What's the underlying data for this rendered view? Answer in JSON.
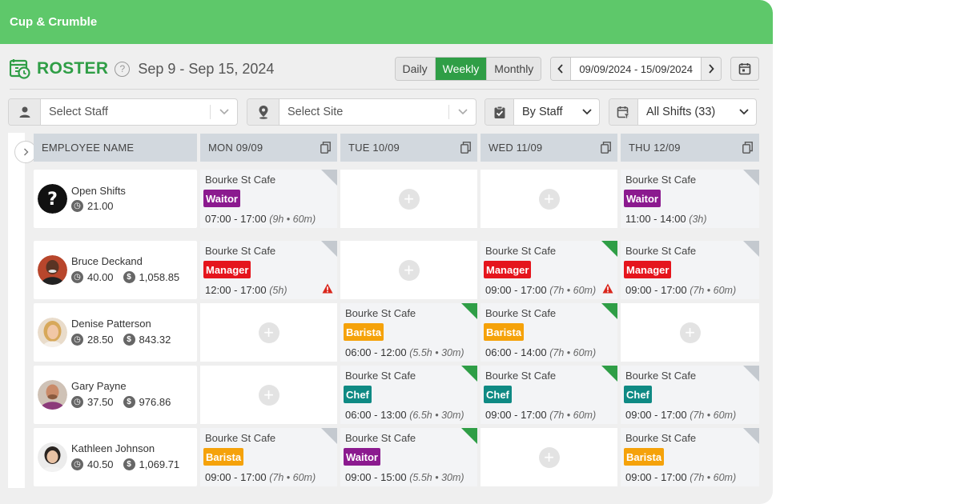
{
  "brand": "Cup & Crumble",
  "header": {
    "title": "ROSTER",
    "help": "?",
    "date_range": "Sep 9 - Sep 15, 2024",
    "views": [
      "Daily",
      "Weekly",
      "Monthly"
    ],
    "active_view": "Weekly",
    "date_field": "09/09/2024 - 15/09/2024"
  },
  "filters": {
    "staff_placeholder": "Select Staff",
    "site_placeholder": "Select Site",
    "group_by": "By Staff",
    "shifts": "All Shifts (33)"
  },
  "columns": [
    "EMPLOYEE NAME",
    "MON 09/09",
    "TUE 10/09",
    "WED 11/09",
    "THU 12/09"
  ],
  "role_colors": {
    "Waitor": "#8b1a8f",
    "Manager": "#e5151d",
    "Barista": "#f5a20a",
    "Chef": "#0f8a84"
  },
  "employees": [
    {
      "name": "Open Shifts",
      "hours": "21.00",
      "pay": "",
      "avatar": "question-icon"
    },
    {
      "name": "Bruce Deckand",
      "hours": "40.00",
      "pay": "1,058.85",
      "avatar": "avatar-bruce"
    },
    {
      "name": "Denise Patterson",
      "hours": "28.50",
      "pay": "843.32",
      "avatar": "avatar-denise"
    },
    {
      "name": "Gary Payne",
      "hours": "37.50",
      "pay": "976.86",
      "avatar": "avatar-gary"
    },
    {
      "name": "Kathleen Johnson",
      "hours": "40.50",
      "pay": "1,069.71",
      "avatar": "avatar-kathleen"
    }
  ],
  "shifts": [
    [
      {
        "site": "Bourke St Cafe",
        "role": "Waitor",
        "time": "07:00 - 17:00",
        "detail": "(9h • 60m)",
        "status": "grey",
        "warning": false
      },
      null,
      null,
      {
        "site": "Bourke St Cafe",
        "role": "Waitor",
        "time": "11:00 - 14:00",
        "detail": "(3h)",
        "status": "grey",
        "warning": false
      }
    ],
    [
      {
        "site": "Bourke St Cafe",
        "role": "Manager",
        "time": "12:00 - 17:00",
        "detail": "(5h)",
        "status": "grey",
        "warning": true
      },
      null,
      {
        "site": "Bourke St Cafe",
        "role": "Manager",
        "time": "09:00 - 17:00",
        "detail": "(7h • 60m)",
        "status": "green",
        "warning": true
      },
      {
        "site": "Bourke St Cafe",
        "role": "Manager",
        "time": "09:00 - 17:00",
        "detail": "(7h • 60m)",
        "status": "grey",
        "warning": false
      }
    ],
    [
      null,
      {
        "site": "Bourke St Cafe",
        "role": "Barista",
        "time": "06:00 - 12:00",
        "detail": "(5.5h • 30m)",
        "status": "green",
        "warning": false
      },
      {
        "site": "Bourke St Cafe",
        "role": "Barista",
        "time": "06:00 - 14:00",
        "detail": "(7h • 60m)",
        "status": "green",
        "warning": false
      },
      null
    ],
    [
      null,
      {
        "site": "Bourke St Cafe",
        "role": "Chef",
        "time": "06:00 - 13:00",
        "detail": "(6.5h • 30m)",
        "status": "green",
        "warning": false
      },
      {
        "site": "Bourke St Cafe",
        "role": "Chef",
        "time": "09:00 - 17:00",
        "detail": "(7h • 60m)",
        "status": "green",
        "warning": false
      },
      {
        "site": "Bourke St Cafe",
        "role": "Chef",
        "time": "09:00 - 17:00",
        "detail": "(7h • 60m)",
        "status": "grey",
        "warning": false
      }
    ],
    [
      {
        "site": "Bourke St Cafe",
        "role": "Barista",
        "time": "09:00 - 17:00",
        "detail": "(7h • 60m)",
        "status": "grey",
        "warning": false
      },
      {
        "site": "Bourke St Cafe",
        "role": "Waitor",
        "time": "09:00 - 15:00",
        "detail": "(5.5h • 30m)",
        "status": "green",
        "warning": false
      },
      null,
      {
        "site": "Bourke St Cafe",
        "role": "Barista",
        "time": "09:00 - 17:00",
        "detail": "(7h • 60m)",
        "status": "grey",
        "warning": false
      }
    ]
  ]
}
